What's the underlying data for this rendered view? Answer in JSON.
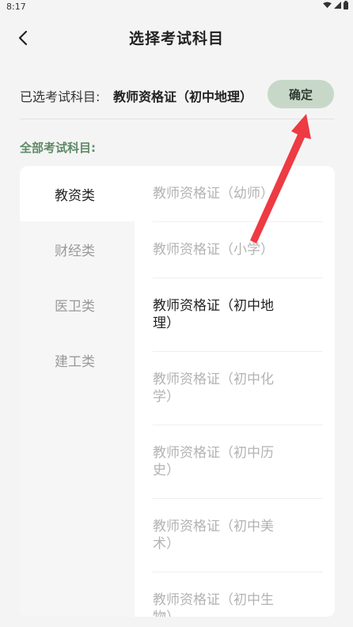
{
  "status_bar": {
    "time": "8:17"
  },
  "header": {
    "title": "选择考试科目"
  },
  "selection": {
    "label": "已选考试科目:",
    "value": "教师资格证（初中地理）",
    "confirm_label": "确定"
  },
  "section_title": "全部考试科目:",
  "categories": [
    {
      "label": "教资类",
      "active": true
    },
    {
      "label": "财经类",
      "active": false
    },
    {
      "label": "医卫类",
      "active": false
    },
    {
      "label": "建工类",
      "active": false
    }
  ],
  "exams": [
    {
      "line1": "教师资格证（幼师）",
      "line2": "",
      "selected": false
    },
    {
      "line1": "教师资格证（小学）",
      "line2": "",
      "selected": false
    },
    {
      "line1": "教师资格证（初中地",
      "line2": "理）",
      "selected": true
    },
    {
      "line1": "教师资格证（初中化",
      "line2": "学）",
      "selected": false
    },
    {
      "line1": "教师资格证（初中历",
      "line2": "史）",
      "selected": false
    },
    {
      "line1": "教师资格证（初中美",
      "line2": "术）",
      "selected": false
    },
    {
      "line1": "教师资格证（初中生",
      "line2": "物）",
      "selected": false
    }
  ],
  "colors": {
    "accent_green": "#5e8a67",
    "confirm_bg": "#c7d8c9",
    "annotation_arrow": "#ee3a43"
  }
}
